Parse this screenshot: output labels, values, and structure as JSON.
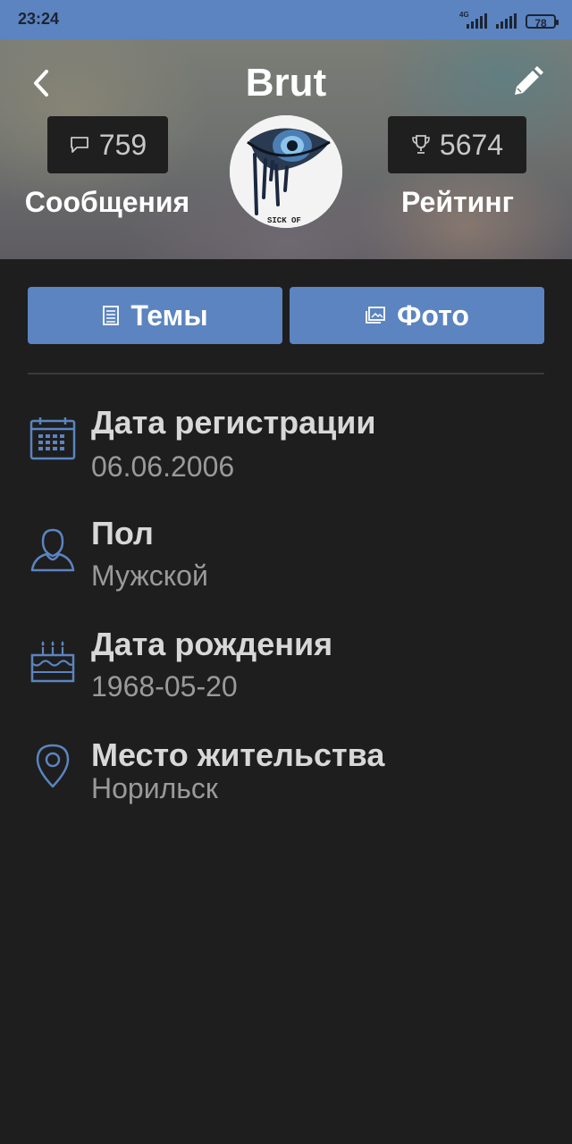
{
  "status_bar": {
    "time": "23:24",
    "network_label": "4G",
    "battery": "78"
  },
  "header": {
    "title": "Brut",
    "messages_count": "759",
    "messages_label": "Сообщения",
    "rating_count": "5674",
    "rating_label": "Рейтинг",
    "avatar_caption": "SICK OF"
  },
  "tabs": [
    {
      "label": "Темы",
      "icon": "document-list-icon"
    },
    {
      "label": "Фото",
      "icon": "photo-album-icon"
    }
  ],
  "info": [
    {
      "label": "Дата регистрации",
      "value": "06.06.2006",
      "icon": "calendar-icon"
    },
    {
      "label": "Пол",
      "value": "Мужской",
      "icon": "person-icon"
    },
    {
      "label": "Дата рождения",
      "value": "1968-05-20",
      "icon": "birthday-cake-icon"
    },
    {
      "label": "Место жительства",
      "value": "Норильск",
      "icon": "location-pin-icon"
    }
  ],
  "colors": {
    "accent": "#5b84c0",
    "background": "#1e1e1e",
    "icon_blue": "#5b84c0"
  }
}
